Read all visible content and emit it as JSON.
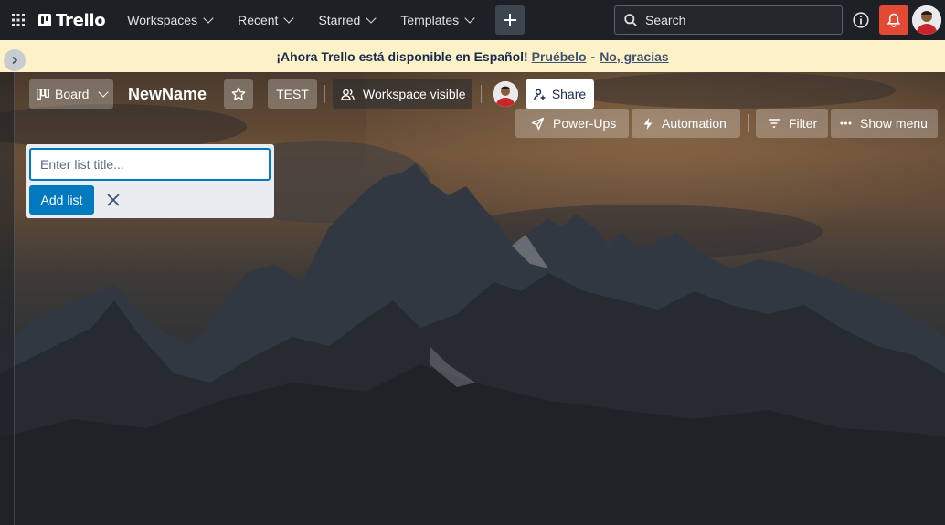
{
  "topnav": {
    "logo_text": "Trello",
    "menus": [
      "Workspaces",
      "Recent",
      "Starred",
      "Templates"
    ],
    "search_label": "Search"
  },
  "banner": {
    "message": "¡Ahora Trello está disponible en Español!",
    "try_link": "Pruébelo",
    "separator": "-",
    "dismiss_link": "No, gracias"
  },
  "board": {
    "view_label": "Board",
    "title": "NewName",
    "workspace_name": "TEST",
    "visibility_label": "Workspace visible",
    "share_label": "Share",
    "powerups_label": "Power-Ups",
    "automation_label": "Automation",
    "filter_label": "Filter",
    "show_menu_label": "Show menu"
  },
  "add_list": {
    "placeholder": "Enter list title...",
    "button_label": "Add list"
  },
  "colors": {
    "nav_bg": "#1d2125",
    "banner_bg": "#fdf1c8",
    "primary_blue": "#0079bf",
    "notification_red": "#e34935"
  }
}
